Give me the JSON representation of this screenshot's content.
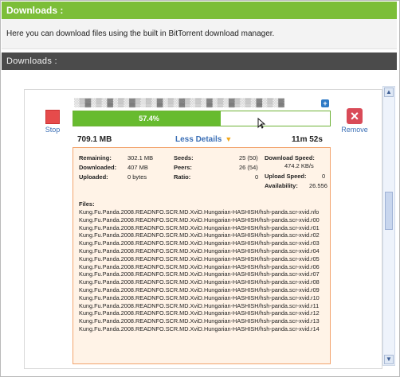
{
  "header": {
    "title": "Downloads :"
  },
  "intro": {
    "text": "Here you can download files using the built in BitTorrent download manager."
  },
  "section": {
    "title": "Downloads :"
  },
  "download": {
    "filename": "░▒▓░▒░▓░▒░▓▒░▒░▓░▒░▓▒░▒░▓░▒░▓▒░▒░▓░▒░▓",
    "stop_label": "Stop",
    "remove_label": "Remove",
    "progress_percent": 57.4,
    "progress_label": "57.4%",
    "size_total": "709.1 MB",
    "less_details_label": "Less Details",
    "eta": "11m 52s",
    "stats": {
      "remaining_label": "Remaining:",
      "remaining_value": "302.1 MB",
      "downloaded_label": "Downloaded:",
      "downloaded_value": "407 MB",
      "uploaded_label": "Uploaded:",
      "uploaded_value": "0 bytes",
      "seeds_label": "Seeds:",
      "seeds_value": "25 (50)",
      "peers_label": "Peers:",
      "peers_value": "26 (54)",
      "ratio_label": "Ratio:",
      "ratio_value": "0",
      "download_speed_label": "Download Speed:",
      "download_speed_value": "474.2 KB/s",
      "upload_speed_label": "Upload Speed:",
      "upload_speed_value": "0",
      "availability_label": "Availability:",
      "availability_value": "26.556"
    },
    "files_label": "Files:",
    "files": [
      "Kung.Fu.Panda.2008.READNFO.SCR.MD.XviD.Hungarian-HASHISH/hsh-panda.scr-xvid.nfo",
      "Kung.Fu.Panda.2008.READNFO.SCR.MD.XviD.Hungarian-HASHISH/hsh-panda.scr-xvid.r00",
      "Kung.Fu.Panda.2008.READNFO.SCR.MD.XviD.Hungarian-HASHISH/hsh-panda.scr-xvid.r01",
      "Kung.Fu.Panda.2008.READNFO.SCR.MD.XviD.Hungarian-HASHISH/hsh-panda.scr-xvid.r02",
      "Kung.Fu.Panda.2008.READNFO.SCR.MD.XviD.Hungarian-HASHISH/hsh-panda.scr-xvid.r03",
      "Kung.Fu.Panda.2008.READNFO.SCR.MD.XviD.Hungarian-HASHISH/hsh-panda.scr-xvid.r04",
      "Kung.Fu.Panda.2008.READNFO.SCR.MD.XviD.Hungarian-HASHISH/hsh-panda.scr-xvid.r05",
      "Kung.Fu.Panda.2008.READNFO.SCR.MD.XviD.Hungarian-HASHISH/hsh-panda.scr-xvid.r06",
      "Kung.Fu.Panda.2008.READNFO.SCR.MD.XviD.Hungarian-HASHISH/hsh-panda.scr-xvid.r07",
      "Kung.Fu.Panda.2008.READNFO.SCR.MD.XviD.Hungarian-HASHISH/hsh-panda.scr-xvid.r08",
      "Kung.Fu.Panda.2008.READNFO.SCR.MD.XviD.Hungarian-HASHISH/hsh-panda.scr-xvid.r09",
      "Kung.Fu.Panda.2008.READNFO.SCR.MD.XviD.Hungarian-HASHISH/hsh-panda.scr-xvid.r10",
      "Kung.Fu.Panda.2008.READNFO.SCR.MD.XviD.Hungarian-HASHISH/hsh-panda.scr-xvid.r11",
      "Kung.Fu.Panda.2008.READNFO.SCR.MD.XviD.Hungarian-HASHISH/hsh-panda.scr-xvid.r12",
      "Kung.Fu.Panda.2008.READNFO.SCR.MD.XviD.Hungarian-HASHISH/hsh-panda.scr-xvid.r13",
      "Kung.Fu.Panda.2008.READNFO.SCR.MD.XviD.Hungarian-HASHISH/hsh-panda.scr-xvid.r14"
    ]
  },
  "icons": {
    "info": "info-icon",
    "stop": "stop-icon",
    "remove": "remove-icon",
    "dropdown": "chevron-down-icon",
    "cursor": "mouse-cursor-icon"
  },
  "colors": {
    "header_green": "#7cbe38",
    "progress_green": "#67bb2f",
    "dark_bar": "#4b4b4b",
    "details_bg": "#fff3e7",
    "details_border": "#f2a46d",
    "link_blue": "#3b6fb6",
    "stop_red": "#e64b4b",
    "remove_red": "#d94b58"
  }
}
